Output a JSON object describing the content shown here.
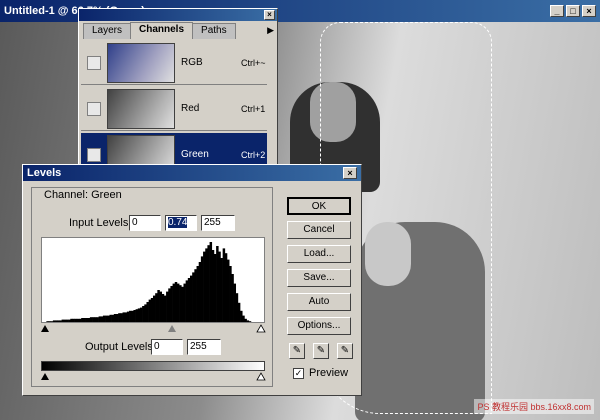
{
  "document": {
    "title": "Untitled-1 @ 66.7% (Green)",
    "buttons": [
      "_",
      "□",
      "×"
    ]
  },
  "channels_panel": {
    "tabs": [
      "Layers",
      "Channels",
      "Paths"
    ],
    "active_tab": "Channels",
    "menu_glyph": "▶",
    "close_glyph": "×",
    "rows": [
      {
        "name": "RGB",
        "shortcut": "Ctrl+~"
      },
      {
        "name": "Red",
        "shortcut": "Ctrl+1"
      },
      {
        "name": "Green",
        "shortcut": "Ctrl+2"
      }
    ]
  },
  "levels": {
    "title": "Levels",
    "close_glyph": "×",
    "channel_label": "Channel:",
    "channel_value": "Green",
    "input_levels_label": "Input Levels:",
    "input_black": "0",
    "input_gamma": "0.74",
    "input_white": "255",
    "output_levels_label": "Output Levels:",
    "output_black": "0",
    "output_white": "255",
    "buttons": {
      "ok": "OK",
      "cancel": "Cancel",
      "load": "Load...",
      "save": "Save...",
      "auto": "Auto",
      "options": "Options..."
    },
    "preview_label": "Preview",
    "preview_checked": true,
    "histogram": [
      0,
      0,
      1,
      1,
      1,
      2,
      2,
      2,
      2,
      3,
      3,
      3,
      3,
      4,
      4,
      4,
      4,
      4,
      5,
      5,
      5,
      5,
      6,
      6,
      6,
      6,
      7,
      7,
      8,
      8,
      8,
      9,
      9,
      10,
      10,
      11,
      11,
      12,
      12,
      13,
      14,
      14,
      15,
      16,
      17,
      18,
      20,
      22,
      25,
      28,
      30,
      33,
      36,
      40,
      38,
      35,
      33,
      38,
      42,
      45,
      48,
      50,
      48,
      46,
      44,
      48,
      52,
      55,
      58,
      62,
      66,
      70,
      75,
      82,
      88,
      92,
      96,
      100,
      90,
      85,
      95,
      88,
      80,
      92,
      86,
      78,
      70,
      60,
      48,
      36,
      24,
      14,
      8,
      4,
      2,
      1,
      0,
      0,
      0,
      0,
      0,
      0
    ]
  },
  "watermark": "PS 教程乐园 bbs.16xx8.com"
}
